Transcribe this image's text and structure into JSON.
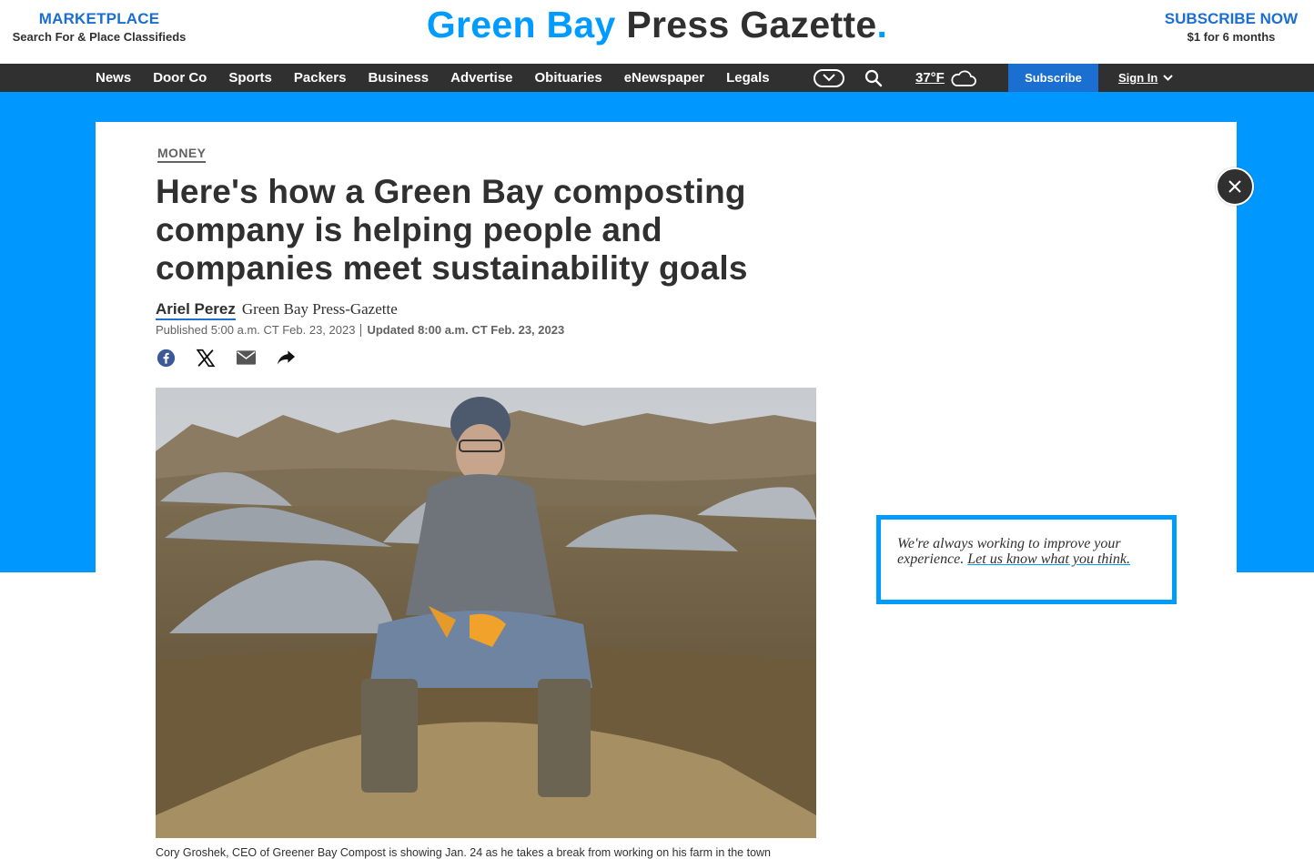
{
  "header": {
    "marketplace_title": "MARKETPLACE",
    "marketplace_sub": "Search For & Place Classifieds",
    "logo_part1": "Green Bay",
    "logo_part2": "Press Gazette",
    "logo_dot": ".",
    "subscribe_title": "SUBSCRIBE NOW",
    "subscribe_sub": "$1 for 6 months"
  },
  "nav": {
    "items": [
      "News",
      "Door Co",
      "Sports",
      "Packers",
      "Business",
      "Advertise",
      "Obituaries",
      "eNewspaper",
      "Legals"
    ],
    "weather": "37°F",
    "subscribe": "Subscribe",
    "sign_in": "Sign In"
  },
  "article": {
    "section": "MONEY",
    "headline": "Here's how a Green Bay composting company is helping people and companies meet sustainability goals",
    "author": "Ariel Perez",
    "outlet": "Green Bay Press-Gazette",
    "published": "Published 5:00 a.m. CT Feb. 23, 2023",
    "updated": "Updated 8:00 a.m. CT Feb. 23, 2023",
    "caption": "Cory Groshek, CEO of Greener Bay Compost is showing Jan. 24 as he takes a break from working on his farm in the town"
  },
  "feedback": {
    "text": "We're always working to improve your experience.",
    "link": "Let us know what you think."
  },
  "colors": {
    "brand_blue": "#009bff",
    "link_blue": "#1a6fd1",
    "nav_bg": "#303030",
    "band_blue": "#0098fe"
  },
  "icons": [
    "chevron-down-icon",
    "search-icon",
    "cloud-icon",
    "facebook-icon",
    "x-icon",
    "email-icon",
    "share-arrow-icon",
    "close-icon"
  ]
}
